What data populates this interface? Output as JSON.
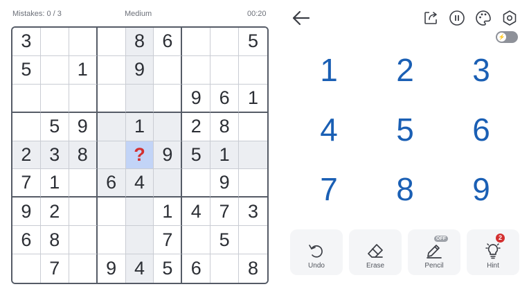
{
  "status": {
    "mistakes": "Mistakes: 0 / 3",
    "difficulty": "Medium",
    "timer": "00:20"
  },
  "board": {
    "cells": [
      [
        "3",
        "",
        "",
        "",
        "8",
        "6",
        "",
        "",
        "5"
      ],
      [
        "5",
        "",
        "1",
        "",
        "9",
        "",
        "",
        "",
        ""
      ],
      [
        "",
        "",
        "",
        "",
        "",
        "",
        "9",
        "6",
        "1"
      ],
      [
        "",
        "5",
        "9",
        "",
        "1",
        "",
        "2",
        "8",
        ""
      ],
      [
        "2",
        "3",
        "8",
        "",
        "?",
        "9",
        "5",
        "1",
        ""
      ],
      [
        "7",
        "1",
        "",
        "6",
        "4",
        "",
        "",
        "9",
        ""
      ],
      [
        "9",
        "2",
        "",
        "",
        "",
        "1",
        "4",
        "7",
        "3"
      ],
      [
        "6",
        "8",
        "",
        "",
        "",
        "7",
        "",
        "5",
        ""
      ],
      [
        "",
        "7",
        "",
        "9",
        "4",
        "5",
        "6",
        "",
        "8"
      ]
    ],
    "selected": {
      "row": 4,
      "col": 4
    }
  },
  "numpad": [
    "1",
    "2",
    "3",
    "4",
    "5",
    "6",
    "7",
    "8",
    "9"
  ],
  "tools": {
    "undo": "Undo",
    "erase": "Erase",
    "pencil": "Pencil",
    "pencil_state": "OFF",
    "hint": "Hint",
    "hint_count": "2"
  },
  "icons": [
    "back-arrow-icon",
    "share-icon",
    "pause-icon",
    "theme-palette-icon",
    "settings-icon",
    "power-toggle-icon"
  ],
  "colors": {
    "number_blue": "#1a5fb4",
    "selected_cell": "#c2d4f7",
    "question_red": "#d32f2f",
    "highlight_gray": "#eceef2"
  }
}
